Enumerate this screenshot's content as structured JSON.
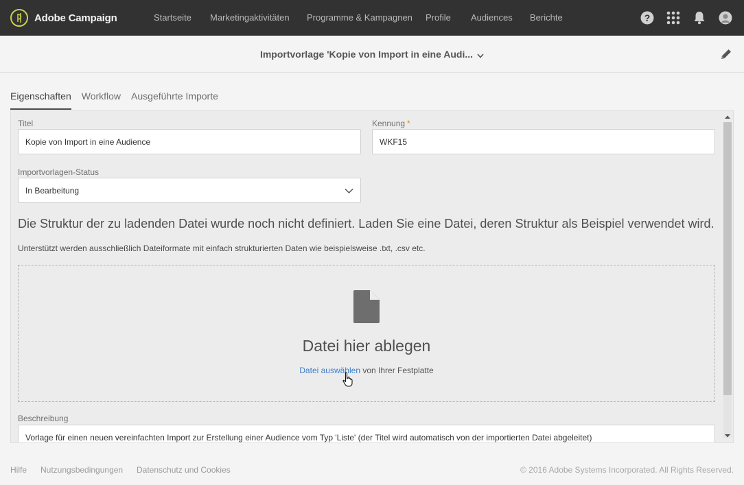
{
  "app": {
    "name": "Adobe Campaign"
  },
  "nav": {
    "items": [
      "Startseite",
      "Marketingaktivitäten",
      "Programme & Kampagnen",
      "Profile",
      "Audiences",
      "Berichte"
    ],
    "icons": [
      "help-icon",
      "apps-grid-icon",
      "bell-icon",
      "avatar-icon"
    ]
  },
  "header": {
    "title": "Importvorlage 'Kopie von Import in eine Audi..."
  },
  "tabs": [
    "Eigenschaften",
    "Workflow",
    "Ausgeführte Importe"
  ],
  "form": {
    "title_label": "Titel",
    "title_value": "Kopie von Import in eine Audience",
    "id_label": "Kennung",
    "id_required": "*",
    "id_value": "WKF15",
    "status_label": "Importvorlagen-Status",
    "status_value": "In Bearbeitung",
    "structure_heading": "Die Struktur der zu ladenden Datei wurde noch nicht definiert. Laden Sie eine Datei, deren Struktur als Beispiel verwendet wird.",
    "supported_text": "Unterstützt werden ausschließlich Dateiformate mit einfach strukturierten Daten wie beispielsweise .txt, .csv etc.",
    "dropzone_title": "Datei hier ablegen",
    "dropzone_link": "Datei auswählen",
    "dropzone_suffix": "von Ihrer Festplatte",
    "description_label": "Beschreibung",
    "description_value": "Vorlage für einen neuen vereinfachten Import zur Erstellung einer Audience vom Typ 'Liste' (der Titel wird automatisch von der importierten Datei abgeleitet)"
  },
  "footer": {
    "links": [
      "Hilfe",
      "Nutzungsbedingungen",
      "Datenschutz und Cookies"
    ],
    "copyright": "© 2016 Adobe Systems Incorporated. All Rights Reserved."
  },
  "colors": {
    "nav_bg": "#323232",
    "accent": "#c8d24b",
    "link": "#3d7fcb",
    "required": "#e68619"
  }
}
